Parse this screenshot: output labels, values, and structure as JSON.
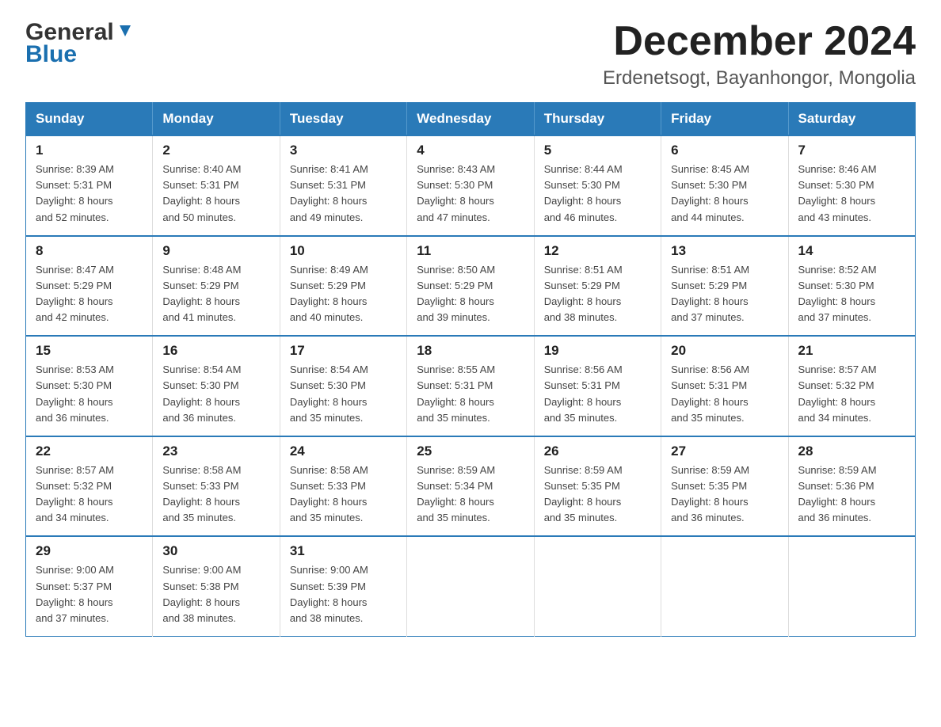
{
  "logo": {
    "general": "General",
    "blue": "Blue"
  },
  "title": "December 2024",
  "subtitle": "Erdenetsogt, Bayanhongor, Mongolia",
  "weekdays": [
    "Sunday",
    "Monday",
    "Tuesday",
    "Wednesday",
    "Thursday",
    "Friday",
    "Saturday"
  ],
  "weeks": [
    [
      {
        "day": "1",
        "sunrise": "8:39 AM",
        "sunset": "5:31 PM",
        "daylight": "8 hours and 52 minutes."
      },
      {
        "day": "2",
        "sunrise": "8:40 AM",
        "sunset": "5:31 PM",
        "daylight": "8 hours and 50 minutes."
      },
      {
        "day": "3",
        "sunrise": "8:41 AM",
        "sunset": "5:31 PM",
        "daylight": "8 hours and 49 minutes."
      },
      {
        "day": "4",
        "sunrise": "8:43 AM",
        "sunset": "5:30 PM",
        "daylight": "8 hours and 47 minutes."
      },
      {
        "day": "5",
        "sunrise": "8:44 AM",
        "sunset": "5:30 PM",
        "daylight": "8 hours and 46 minutes."
      },
      {
        "day": "6",
        "sunrise": "8:45 AM",
        "sunset": "5:30 PM",
        "daylight": "8 hours and 44 minutes."
      },
      {
        "day": "7",
        "sunrise": "8:46 AM",
        "sunset": "5:30 PM",
        "daylight": "8 hours and 43 minutes."
      }
    ],
    [
      {
        "day": "8",
        "sunrise": "8:47 AM",
        "sunset": "5:29 PM",
        "daylight": "8 hours and 42 minutes."
      },
      {
        "day": "9",
        "sunrise": "8:48 AM",
        "sunset": "5:29 PM",
        "daylight": "8 hours and 41 minutes."
      },
      {
        "day": "10",
        "sunrise": "8:49 AM",
        "sunset": "5:29 PM",
        "daylight": "8 hours and 40 minutes."
      },
      {
        "day": "11",
        "sunrise": "8:50 AM",
        "sunset": "5:29 PM",
        "daylight": "8 hours and 39 minutes."
      },
      {
        "day": "12",
        "sunrise": "8:51 AM",
        "sunset": "5:29 PM",
        "daylight": "8 hours and 38 minutes."
      },
      {
        "day": "13",
        "sunrise": "8:51 AM",
        "sunset": "5:29 PM",
        "daylight": "8 hours and 37 minutes."
      },
      {
        "day": "14",
        "sunrise": "8:52 AM",
        "sunset": "5:30 PM",
        "daylight": "8 hours and 37 minutes."
      }
    ],
    [
      {
        "day": "15",
        "sunrise": "8:53 AM",
        "sunset": "5:30 PM",
        "daylight": "8 hours and 36 minutes."
      },
      {
        "day": "16",
        "sunrise": "8:54 AM",
        "sunset": "5:30 PM",
        "daylight": "8 hours and 36 minutes."
      },
      {
        "day": "17",
        "sunrise": "8:54 AM",
        "sunset": "5:30 PM",
        "daylight": "8 hours and 35 minutes."
      },
      {
        "day": "18",
        "sunrise": "8:55 AM",
        "sunset": "5:31 PM",
        "daylight": "8 hours and 35 minutes."
      },
      {
        "day": "19",
        "sunrise": "8:56 AM",
        "sunset": "5:31 PM",
        "daylight": "8 hours and 35 minutes."
      },
      {
        "day": "20",
        "sunrise": "8:56 AM",
        "sunset": "5:31 PM",
        "daylight": "8 hours and 35 minutes."
      },
      {
        "day": "21",
        "sunrise": "8:57 AM",
        "sunset": "5:32 PM",
        "daylight": "8 hours and 34 minutes."
      }
    ],
    [
      {
        "day": "22",
        "sunrise": "8:57 AM",
        "sunset": "5:32 PM",
        "daylight": "8 hours and 34 minutes."
      },
      {
        "day": "23",
        "sunrise": "8:58 AM",
        "sunset": "5:33 PM",
        "daylight": "8 hours and 35 minutes."
      },
      {
        "day": "24",
        "sunrise": "8:58 AM",
        "sunset": "5:33 PM",
        "daylight": "8 hours and 35 minutes."
      },
      {
        "day": "25",
        "sunrise": "8:59 AM",
        "sunset": "5:34 PM",
        "daylight": "8 hours and 35 minutes."
      },
      {
        "day": "26",
        "sunrise": "8:59 AM",
        "sunset": "5:35 PM",
        "daylight": "8 hours and 35 minutes."
      },
      {
        "day": "27",
        "sunrise": "8:59 AM",
        "sunset": "5:35 PM",
        "daylight": "8 hours and 36 minutes."
      },
      {
        "day": "28",
        "sunrise": "8:59 AM",
        "sunset": "5:36 PM",
        "daylight": "8 hours and 36 minutes."
      }
    ],
    [
      {
        "day": "29",
        "sunrise": "9:00 AM",
        "sunset": "5:37 PM",
        "daylight": "8 hours and 37 minutes."
      },
      {
        "day": "30",
        "sunrise": "9:00 AM",
        "sunset": "5:38 PM",
        "daylight": "8 hours and 38 minutes."
      },
      {
        "day": "31",
        "sunrise": "9:00 AM",
        "sunset": "5:39 PM",
        "daylight": "8 hours and 38 minutes."
      },
      null,
      null,
      null,
      null
    ]
  ]
}
